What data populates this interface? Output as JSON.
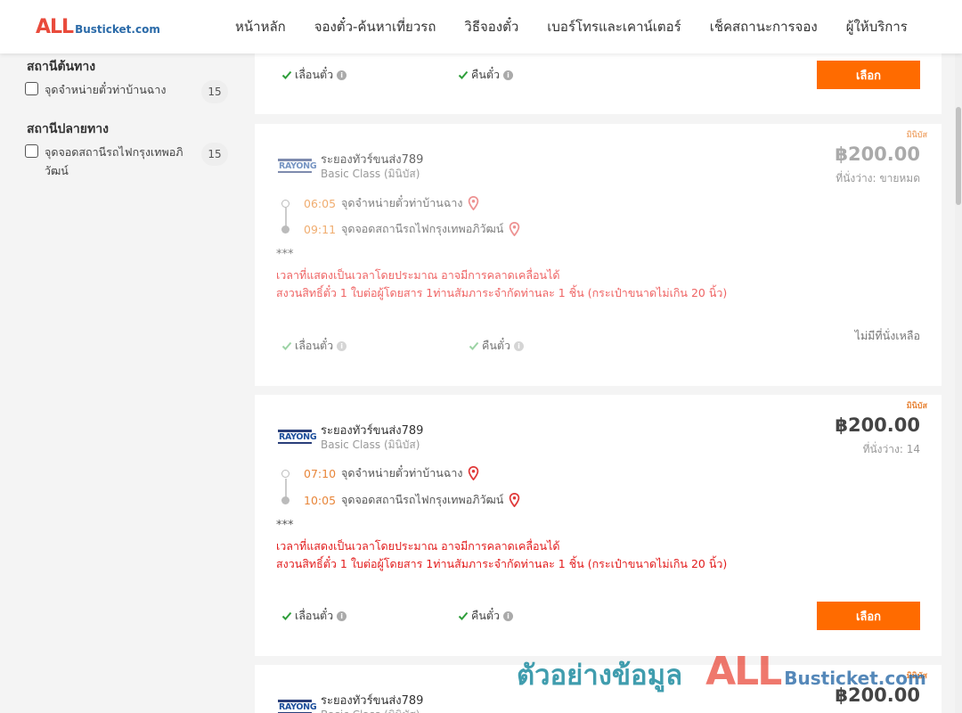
{
  "header": {
    "logo_main": "ALL",
    "logo_rest": "Busticket.com",
    "nav": [
      "หน้าหลัก",
      "จองตั๋ว-ค้นหาเที่ยวรถ",
      "วิธีจองตั๋ว",
      "เบอร์โทรและเคาน์เตอร์",
      "เช็คสถานะการจอง",
      "ผู้ให้บริการ"
    ]
  },
  "sidebar": {
    "origin_title": "สถานีต้นทาง",
    "origin_items": [
      {
        "label": "จุดจำหน่ายตั๋วท่าบ้านฉาง",
        "count": "15"
      }
    ],
    "destination_title": "สถานีปลายทาง",
    "destination_items": [
      {
        "label": "จุดจอดสถานีรถไฟกรุงเทพอภิวัฒน์",
        "count": "15"
      }
    ]
  },
  "card0": {
    "feature_change": "เลื่อนตั๋ว",
    "feature_refund": "คืนตั๋ว",
    "select_label": "เลือก"
  },
  "card1": {
    "tag": "มินิบัส",
    "logo_text": "RAYONG",
    "operator": "ระยองทัวร์ขนส่ง789",
    "bus_class": "Basic Class (มินิบัส)",
    "price": "฿200.00",
    "seats": "ที่นั่งว่าง: ขายหมด",
    "depart_time": "06:05",
    "depart_stop": "จุดจำหน่ายตั๋วท่าบ้านฉาง",
    "arrive_time": "09:11",
    "arrive_stop": "จุดจอดสถานีรถไฟกรุงเทพอภิวัฒน์",
    "stars": "***",
    "note1": "เวลาที่แสดงเป็นเวลาโดยประมาณ อาจมีการคลาดเคลื่อนได้",
    "note2": "สงวนสิทธิ์ตั๋ว 1 ใบต่อผู้โดยสาร 1ท่านสัมภาระจำกัดท่านละ 1 ชิ้น (กระเป๋าขนาดไม่เกิน 20 นิ้ว)",
    "feature_change": "เลื่อนตั๋ว",
    "feature_refund": "คืนตั๋ว",
    "no_seat": "ไม่มีที่นั่งเหลือ"
  },
  "card2": {
    "tag": "มินิบัส",
    "logo_text": "RAYONG",
    "operator": "ระยองทัวร์ขนส่ง789",
    "bus_class": "Basic Class (มินิบัส)",
    "price": "฿200.00",
    "seats": "ที่นั่งว่าง: 14",
    "depart_time": "07:10",
    "depart_stop": "จุดจำหน่ายตั๋วท่าบ้านฉาง",
    "arrive_time": "10:05",
    "arrive_stop": "จุดจอดสถานีรถไฟกรุงเทพอภิวัฒน์",
    "stars": "***",
    "note1": "เวลาที่แสดงเป็นเวลาโดยประมาณ อาจมีการคลาดเคลื่อนได้",
    "note2": "สงวนสิทธิ์ตั๋ว 1 ใบต่อผู้โดยสาร 1ท่านสัมภาระจำกัดท่านละ 1 ชิ้น (กระเป๋าขนาดไม่เกิน 20 นิ้ว)",
    "feature_change": "เลื่อนตั๋ว",
    "feature_refund": "คืนตั๋ว",
    "select_label": "เลือก"
  },
  "card3": {
    "tag": "มินิบัส",
    "logo_text": "RAYONG",
    "operator": "ระยองทัวร์ขนส่ง789",
    "bus_class": "Basic Class (มินิบัส)",
    "price": "฿200.00"
  },
  "watermark": {
    "text": "ตัวอย่างข้อมูล",
    "brand_main": "ALL",
    "brand_rest": "Busticket.com"
  },
  "colors": {
    "accent_orange": "#ff6b00",
    "note_red": "#e21b1b",
    "time_orange": "#e8863a",
    "pin_red": "#e03a3a",
    "check_green": "#2e9e3a"
  }
}
